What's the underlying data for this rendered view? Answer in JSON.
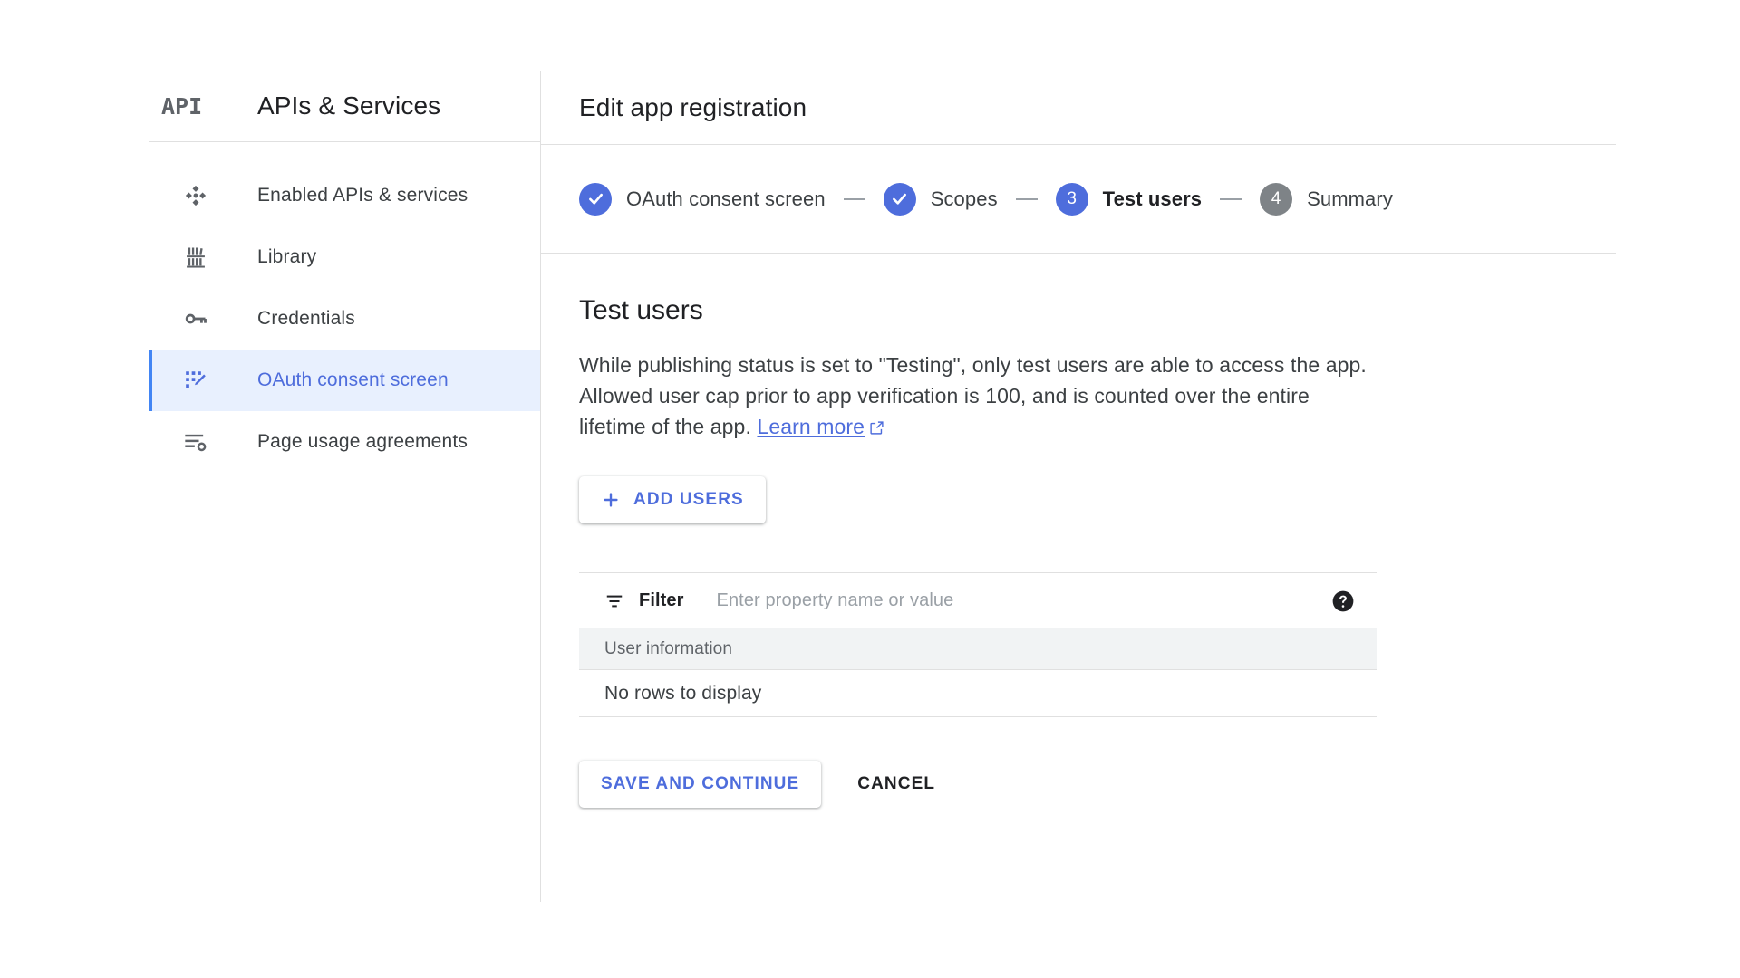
{
  "sidebar": {
    "brand": {
      "logo_text": "API",
      "title": "APIs & Services"
    },
    "items": [
      {
        "label": "Enabled APIs & services",
        "icon": "api-diamond-icon",
        "active": false
      },
      {
        "label": "Library",
        "icon": "library-bookshelf-icon",
        "active": false
      },
      {
        "label": "Credentials",
        "icon": "key-icon",
        "active": false
      },
      {
        "label": "OAuth consent screen",
        "icon": "oauth-consent-icon",
        "active": true
      },
      {
        "label": "Page usage agreements",
        "icon": "page-usage-agreements-icon",
        "active": false
      }
    ]
  },
  "header": {
    "title": "Edit app registration"
  },
  "stepper": {
    "steps": [
      {
        "badge": "✓",
        "label": "OAuth consent screen",
        "state": "done"
      },
      {
        "badge": "✓",
        "label": "Scopes",
        "state": "done"
      },
      {
        "badge": "3",
        "label": "Test users",
        "state": "current"
      },
      {
        "badge": "4",
        "label": "Summary",
        "state": "upcoming"
      }
    ],
    "separator": "—"
  },
  "content": {
    "section_title": "Test users",
    "description_part1": "While publishing status is set to \"Testing\", only test users are able to access the app. Allowed user cap prior to app verification is 100, and is counted over the entire lifetime of the app. ",
    "learn_more_label": "Learn more",
    "add_users_label": "ADD USERS",
    "user_cap": "100",
    "publishing_status": "Testing"
  },
  "filter": {
    "label": "Filter",
    "placeholder": "Enter property name or value",
    "value": "",
    "help_icon": "help-circle-icon"
  },
  "table": {
    "columns": [
      "User information"
    ],
    "rows": [],
    "empty_message": "No rows to display"
  },
  "actions": {
    "save_label": "SAVE AND CONTINUE",
    "cancel_label": "CANCEL"
  },
  "colors": {
    "accent_blue": "#4e6ddc",
    "active_nav_bg": "#e8f0fe",
    "active_nav_border": "#4285f4",
    "upcoming_gray": "#7e8387",
    "table_header_bg": "#f1f3f4",
    "text_primary": "#202124",
    "text_secondary": "#5f6368",
    "divider": "#e0e0e0"
  }
}
